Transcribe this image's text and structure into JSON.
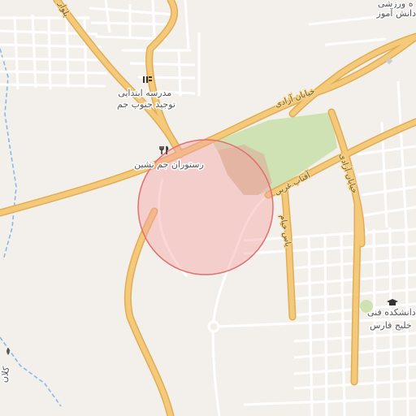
{
  "map": {
    "labels": {
      "school": "مدرسه ابتدایی\nتوجید جنوب جم",
      "restaurant": "رستوران جم نشین",
      "college": "دانشکده فنی\nخلیج فارس",
      "top_right": "ه ورزشی\nدانش آموز",
      "left_edge": "کلان",
      "street_azadi_1": "خیابان آزادی",
      "street_azadi_2": "خیابان آزادی",
      "street_aftab": "آفتاب غربی",
      "street_khayyam": "یاس خیام",
      "top_street": "بلوار"
    },
    "colors": {
      "background": "#f3f0eb",
      "major_road": "#f5c97a",
      "major_road_casing": "#e0ad55",
      "minor_road": "#ffffff",
      "park": "#cfe2b4",
      "park_brown": "#d7c3a3",
      "highlight_fill": "#f5a3a3",
      "highlight_stroke": "#e07070",
      "water_dash": "#8bb7e6"
    },
    "icons": [
      "school-icon",
      "restaurant-icon",
      "college-icon",
      "park-icon"
    ]
  }
}
